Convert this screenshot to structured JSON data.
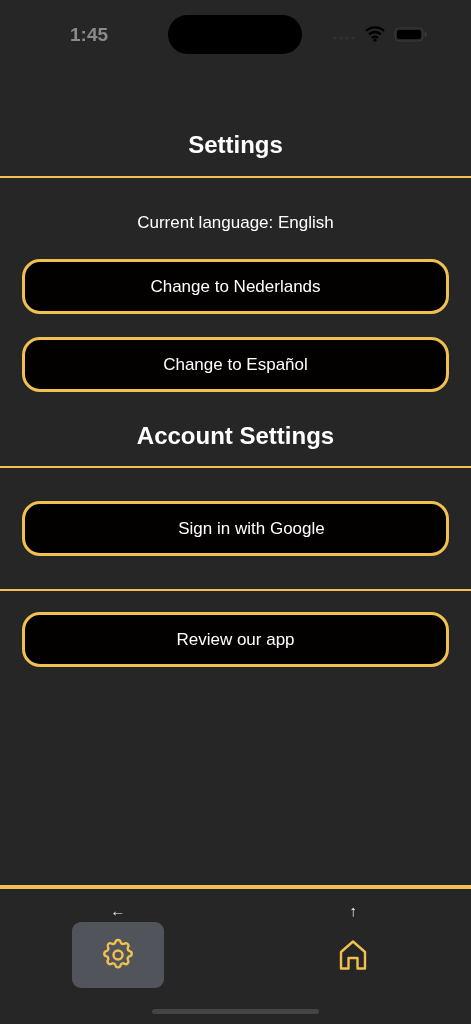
{
  "status_bar": {
    "time": "1:45"
  },
  "title": "Settings",
  "current_language": "Current language: English",
  "language_buttons": [
    "Change to Nederlands",
    "Change to Español"
  ],
  "account_heading": "Account Settings",
  "account_buttons": [
    "Sign in with Google"
  ],
  "review_button": "Review our app",
  "tab_bar": [
    {
      "hint": "←",
      "kind": "settings",
      "selected": true
    },
    {
      "hint": "↑",
      "kind": "home",
      "selected": false
    }
  ]
}
